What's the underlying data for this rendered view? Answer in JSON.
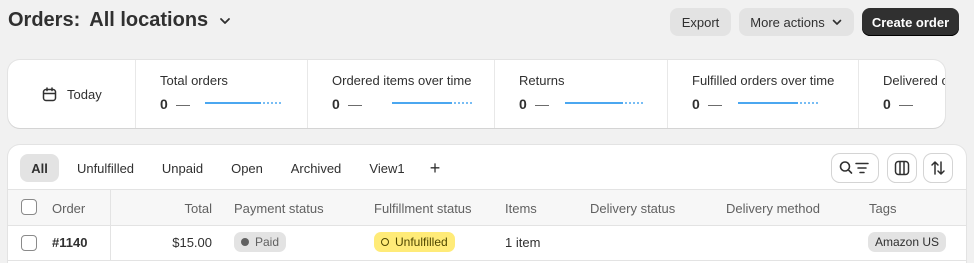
{
  "header": {
    "title": "Orders:",
    "location": "All locations",
    "export_label": "Export",
    "more_actions_label": "More actions",
    "create_order_label": "Create order"
  },
  "metrics": {
    "date_label": "Today",
    "items": [
      {
        "label": "Total orders",
        "value": "0",
        "dash": "—"
      },
      {
        "label": "Ordered items over time",
        "value": "0",
        "dash": "—"
      },
      {
        "label": "Returns",
        "value": "0",
        "dash": "—"
      },
      {
        "label": "Fulfilled orders over time",
        "value": "0",
        "dash": "—"
      },
      {
        "label": "Delivered orders over time",
        "value": "0",
        "dash": "—"
      }
    ]
  },
  "tabs": [
    "All",
    "Unfulfilled",
    "Unpaid",
    "Open",
    "Archived",
    "View1"
  ],
  "add_view_label": "+",
  "table": {
    "columns": [
      "Order",
      "Total",
      "Payment status",
      "Fulfillment status",
      "Items",
      "Delivery status",
      "Delivery method",
      "Tags"
    ],
    "rows": [
      {
        "order": "#1140",
        "total": "$15.00",
        "payment": "Paid",
        "fulfillment": "Unfulfilled",
        "items": "1 item",
        "delivery_status": "",
        "delivery_method": "",
        "tag": "Amazon US"
      }
    ]
  },
  "colors": {
    "primary_button": "#303030",
    "unfulfilled_badge": "#ffeb78",
    "sparkline": "#4ba7f0"
  },
  "icons": [
    "chevron-down-icon",
    "calendar-icon",
    "search-filter-icon",
    "columns-icon",
    "sort-icon"
  ]
}
